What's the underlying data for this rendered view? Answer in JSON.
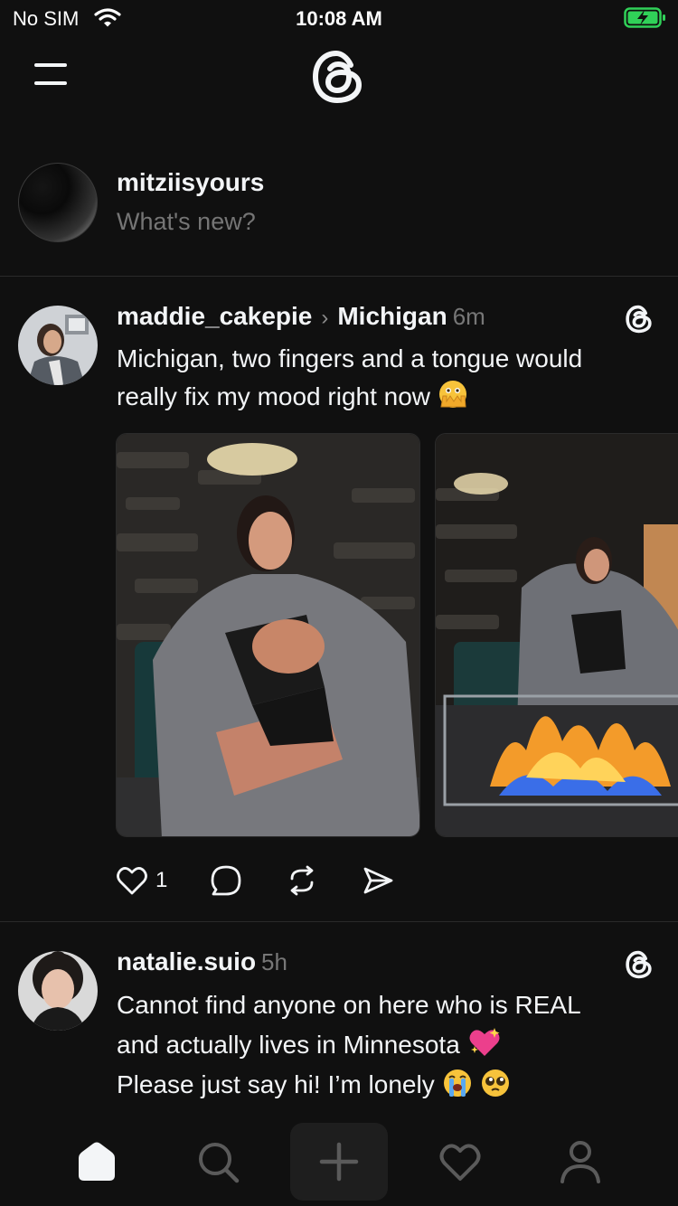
{
  "status_bar": {
    "carrier": "No SIM",
    "time": "10:08 AM",
    "battery_color": "#30d158"
  },
  "header": {
    "menu_icon": "hamburger-menu-icon",
    "logo_icon": "threads-logo-icon"
  },
  "composer": {
    "username": "mitziisyours",
    "placeholder": "What's new?"
  },
  "posts": [
    {
      "username": "maddie_cakepie",
      "topic": "Michigan",
      "time": "6m",
      "text_lines": [
        "Michigan, two fingers and a tongue would",
        "really fix my mood right now"
      ],
      "emoji": [
        "face-with-open-eyes-and-hand-over-mouth-emoji"
      ],
      "images": [
        "photo-woman-in-robe-by-stone-wall",
        "photo-woman-by-fire-pit"
      ],
      "like_count": "1"
    },
    {
      "username": "natalie.suio",
      "time": "5h",
      "text_lines": [
        "Cannot find anyone on here who is REAL",
        "and actually lives in Minnesota",
        "Please just say hi! I’m lonely"
      ],
      "emoji": [
        "sparkling-heart-emoji",
        "loudly-crying-face-emoji",
        "pleading-face-emoji"
      ]
    }
  ],
  "bottom_nav": [
    "home-icon",
    "search-icon",
    "new-thread-icon",
    "activity-heart-icon",
    "profile-icon"
  ],
  "colors": {
    "background": "#101010",
    "text": "#f3f5f7",
    "muted": "#777777",
    "divider": "#2a2a2a"
  }
}
